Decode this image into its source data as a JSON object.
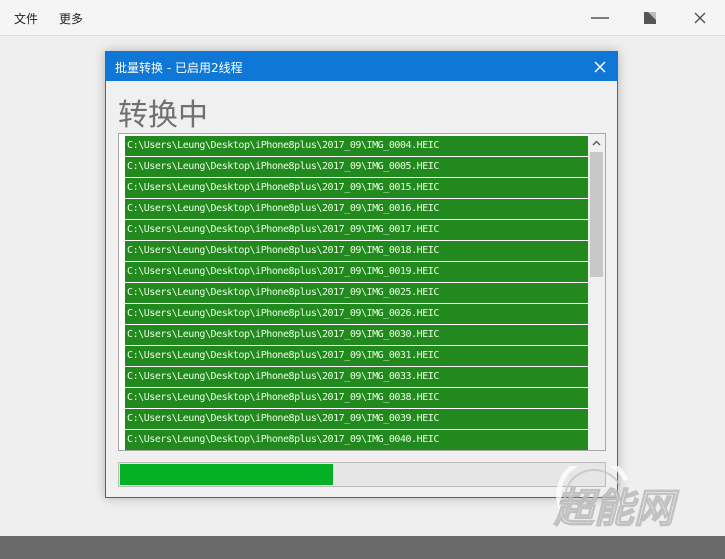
{
  "menubar": {
    "items": [
      "文件",
      "更多"
    ]
  },
  "dialog": {
    "title": "批量转换 - 已启用2线程",
    "heading": "转换中",
    "files": [
      "C:\\Users\\Leung\\Desktop\\iPhone8plus\\2017_09\\IMG_0004.HEIC",
      "C:\\Users\\Leung\\Desktop\\iPhone8plus\\2017_09\\IMG_0005.HEIC",
      "C:\\Users\\Leung\\Desktop\\iPhone8plus\\2017_09\\IMG_0015.HEIC",
      "C:\\Users\\Leung\\Desktop\\iPhone8plus\\2017_09\\IMG_0016.HEIC",
      "C:\\Users\\Leung\\Desktop\\iPhone8plus\\2017_09\\IMG_0017.HEIC",
      "C:\\Users\\Leung\\Desktop\\iPhone8plus\\2017_09\\IMG_0018.HEIC",
      "C:\\Users\\Leung\\Desktop\\iPhone8plus\\2017_09\\IMG_0019.HEIC",
      "C:\\Users\\Leung\\Desktop\\iPhone8plus\\2017_09\\IMG_0025.HEIC",
      "C:\\Users\\Leung\\Desktop\\iPhone8plus\\2017_09\\IMG_0026.HEIC",
      "C:\\Users\\Leung\\Desktop\\iPhone8plus\\2017_09\\IMG_0030.HEIC",
      "C:\\Users\\Leung\\Desktop\\iPhone8plus\\2017_09\\IMG_0031.HEIC",
      "C:\\Users\\Leung\\Desktop\\iPhone8plus\\2017_09\\IMG_0033.HEIC",
      "C:\\Users\\Leung\\Desktop\\iPhone8plus\\2017_09\\IMG_0038.HEIC",
      "C:\\Users\\Leung\\Desktop\\iPhone8plus\\2017_09\\IMG_0039.HEIC",
      "C:\\Users\\Leung\\Desktop\\iPhone8plus\\2017_09\\IMG_0040.HEIC"
    ],
    "progress_fraction": 0.44
  },
  "watermark": {
    "text": "超能网"
  },
  "colors": {
    "dialog_titlebar": "#0f78d7",
    "row_background": "#22891f",
    "progress_fill": "#06b025",
    "bottom_bar": "#6a6a6a"
  }
}
